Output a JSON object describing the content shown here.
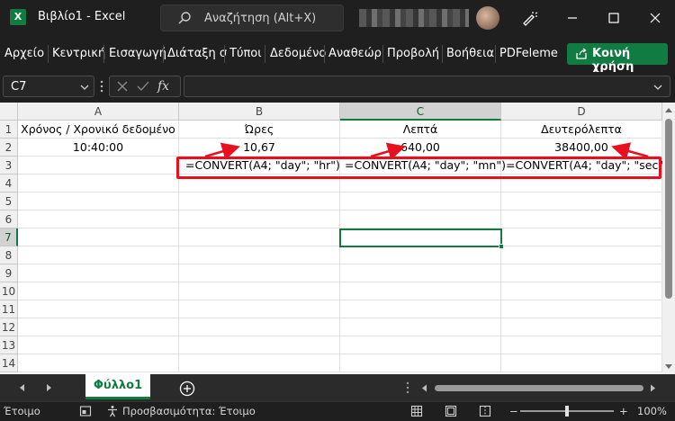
{
  "window": {
    "app_icon": "X",
    "title": "Βιβλίο1 - Excel",
    "search_placeholder": "Αναζήτηση (Alt+X)"
  },
  "ribbon": {
    "tabs": [
      "Αρχείο",
      "Κεντρική",
      "Εισαγωγή",
      "Διάταξη σ",
      "Τύποι",
      "Δεδομένο",
      "Αναθεώρ",
      "Προβολή",
      "Βοήθεια",
      "PDFeleme"
    ],
    "share_label": "Κοινή χρήση"
  },
  "formula_bar": {
    "name_box": "C7",
    "formula": ""
  },
  "grid": {
    "columns": [
      "A",
      "B",
      "C",
      "D"
    ],
    "rows": [
      "1",
      "2",
      "3",
      "4",
      "5",
      "6",
      "7",
      "8",
      "9",
      "10",
      "11",
      "12",
      "13",
      "14"
    ],
    "cells": {
      "A1": "Χρόνος / Χρονικό δεδομένο",
      "B1": "Ώρες",
      "C1": "Λεπτά",
      "D1": "Δευτερόλεπτα",
      "A2": "10:40:00",
      "B2": "10,67",
      "C2": "640,00",
      "D2": "38400,00",
      "B3": "=CONVERT(A4; \"day\"; \"hr\")",
      "C3": "=CONVERT(A4; \"day\"; \"mn\")",
      "D3": "=CONVERT(A4; \"day\"; \"sec\")"
    },
    "selected_column": "C",
    "selected_row": "7"
  },
  "sheets": {
    "active": "Φύλλο1"
  },
  "status": {
    "ready": "Έτοιμο",
    "accessibility": "Προσβασιμότητα: Έτοιμο",
    "zoom": "100%"
  },
  "colors": {
    "excel_green": "#107c41",
    "annotation_red": "#e8101e",
    "chrome_dark": "#1f1f1f"
  }
}
